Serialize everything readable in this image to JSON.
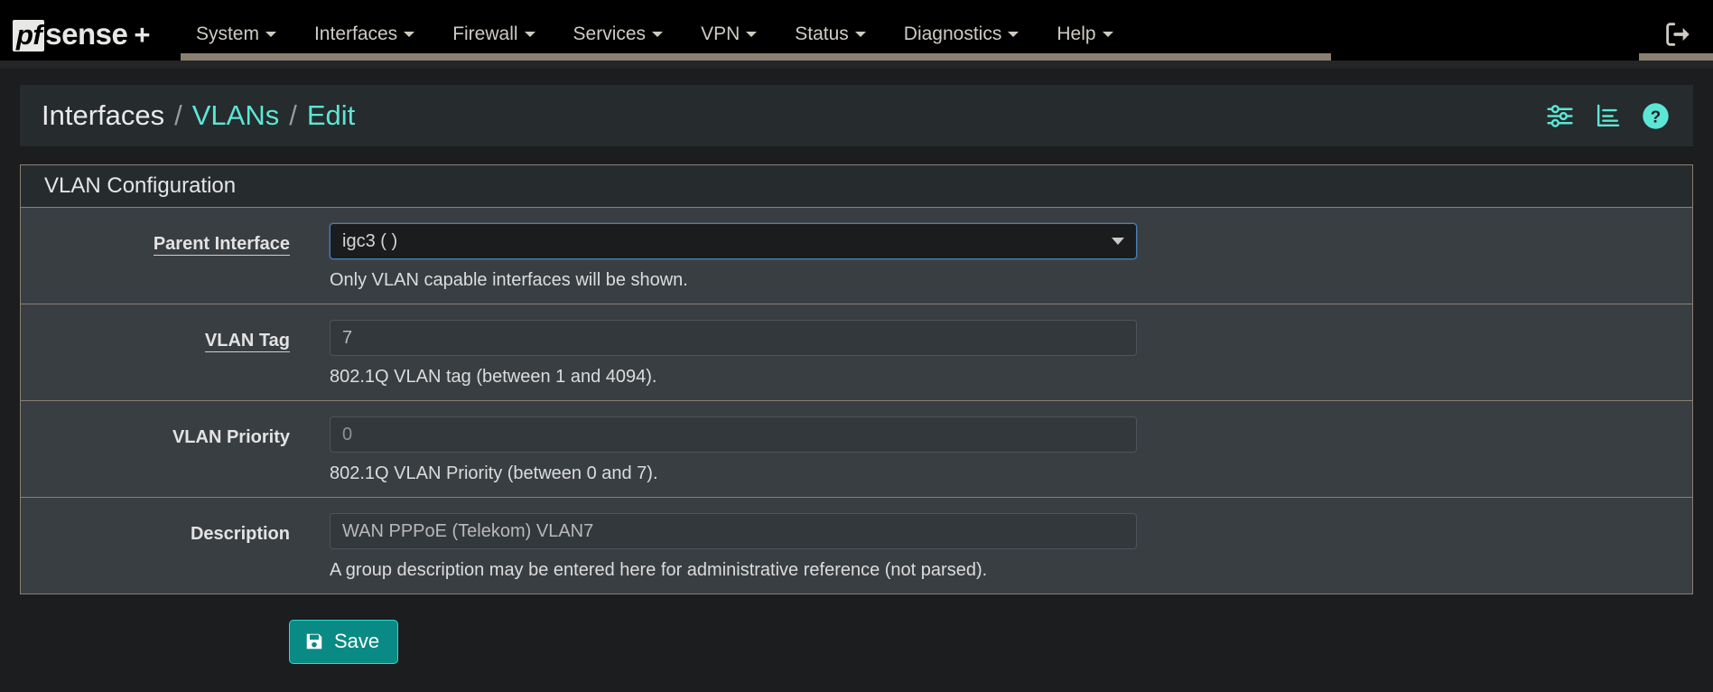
{
  "brand": {
    "pf": "pf",
    "sense": "sense",
    "plus": "+"
  },
  "nav": {
    "items": [
      {
        "label": "System",
        "icon": "chevron-down-icon"
      },
      {
        "label": "Interfaces",
        "icon": "chevron-down-icon"
      },
      {
        "label": "Firewall",
        "icon": "chevron-down-icon"
      },
      {
        "label": "Services",
        "icon": "chevron-down-icon"
      },
      {
        "label": "VPN",
        "icon": "chevron-down-icon"
      },
      {
        "label": "Status",
        "icon": "chevron-down-icon"
      },
      {
        "label": "Diagnostics",
        "icon": "chevron-down-icon"
      },
      {
        "label": "Help",
        "icon": "chevron-down-icon"
      }
    ],
    "logout_icon": "logout-icon",
    "accent_color": "#8a8071",
    "background": "#000000"
  },
  "breadcrumb": {
    "root": "Interfaces",
    "separator": "/",
    "links": [
      {
        "label": "VLANs"
      },
      {
        "label": "Edit"
      }
    ],
    "link_color": "#5ce6d5",
    "icons": [
      {
        "name": "sliders-icon"
      },
      {
        "name": "list-chart-icon"
      },
      {
        "name": "help-circle-icon"
      }
    ]
  },
  "panel": {
    "title": "VLAN Configuration",
    "border_color": "#8a8071",
    "rows": [
      {
        "label": "Parent Interface",
        "label_underlined": true,
        "control": "select",
        "value": "igc3 (                    )",
        "help": "Only VLAN capable interfaces will be shown.",
        "name": "parent-interface"
      },
      {
        "label": "VLAN Tag",
        "label_underlined": true,
        "control": "input",
        "value": "7",
        "placeholder": "",
        "help": "802.1Q VLAN tag (between 1 and 4094).",
        "name": "vlan-tag"
      },
      {
        "label": "VLAN Priority",
        "label_underlined": false,
        "control": "input",
        "value": "",
        "placeholder": "0",
        "help": "802.1Q VLAN Priority (between 0 and 7).",
        "name": "vlan-priority"
      },
      {
        "label": "Description",
        "label_underlined": false,
        "control": "input",
        "value": "WAN PPPoE (Telekom) VLAN7",
        "placeholder": "",
        "help": "A group description may be entered here for administrative reference (not parsed).",
        "name": "description"
      }
    ]
  },
  "actions": {
    "save_label": "Save",
    "save_icon": "floppy-save-icon",
    "save_color": "#0a8a85"
  }
}
